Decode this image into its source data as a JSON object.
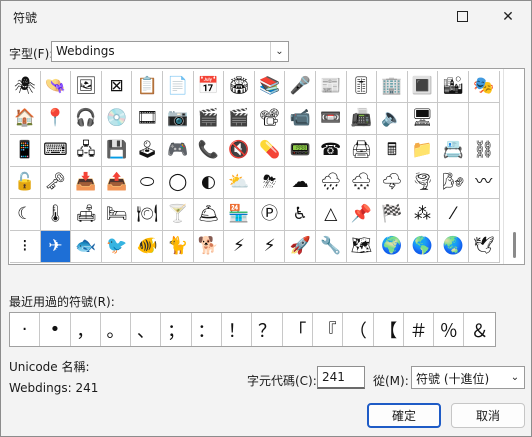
{
  "window": {
    "title": "符號",
    "maximize_label": "□",
    "close_label": "✕"
  },
  "font": {
    "label": "字型(F):",
    "value": "Webdings",
    "arrow": "⌄"
  },
  "grid": {
    "rows": [
      [
        "🕷",
        "👒",
        "🖼",
        "⊠",
        "📋",
        "📄",
        "📅",
        "🏟",
        "📚",
        "🎤",
        "📰",
        "🎚",
        "🏢",
        "🔳",
        "🏙",
        "🎭",
        "🎵"
      ],
      [
        "🏠",
        "📍",
        "🎧",
        "💿",
        "🎞",
        "📷",
        "🎬",
        "🎬",
        "📽",
        "📹",
        "📼",
        "📠",
        "🔈",
        "🖥"
      ],
      [
        "📱",
        "⌨",
        "🖧",
        "💾",
        "🕹",
        "🎮",
        "📞",
        "🔇",
        "💊",
        "📟",
        "☎",
        "🖨",
        "🖩",
        "📁",
        "📇",
        "⛓",
        "🔒"
      ],
      [
        "🔓",
        "🗝",
        "📥",
        "📤",
        "⬭",
        "◯",
        "◐",
        "⛅",
        "⛈",
        "☁",
        "🌧",
        "🌨",
        "🌩",
        "🌪",
        "🌬",
        "〰"
      ],
      [
        "☾",
        "🌡",
        "🛋",
        "🛏",
        "🍽",
        "🍸",
        "🛎",
        "🏪",
        "Ⓟ",
        "♿",
        "△",
        "📌",
        "🏁",
        "⁂",
        "⁄"
      ],
      [
        "⁝",
        "✈",
        "🐟",
        "🐦",
        "🐠",
        "🐈",
        "🐕",
        "⚡",
        "⚡",
        "🚀",
        "🔧",
        "🗺",
        "🌍",
        "🌎",
        "🌏",
        "🕊"
      ]
    ],
    "selected": "✈"
  },
  "recent": {
    "label": "最近用過的符號(R):",
    "symbols": [
      "·",
      "•",
      "，",
      "。",
      "、",
      "；",
      "：",
      "！",
      "？",
      "「",
      "『",
      "（",
      "【",
      "＃",
      "％",
      "＆"
    ]
  },
  "unicode": {
    "name_label": "Unicode 名稱:",
    "value": "Webdings: 241"
  },
  "char_code": {
    "label": "字元代碼(C):",
    "value": "241"
  },
  "from": {
    "label": "從(M):",
    "value": "符號 (十進位)",
    "arrow": "⌄"
  },
  "buttons": {
    "ok": "確定",
    "cancel": "取消"
  }
}
